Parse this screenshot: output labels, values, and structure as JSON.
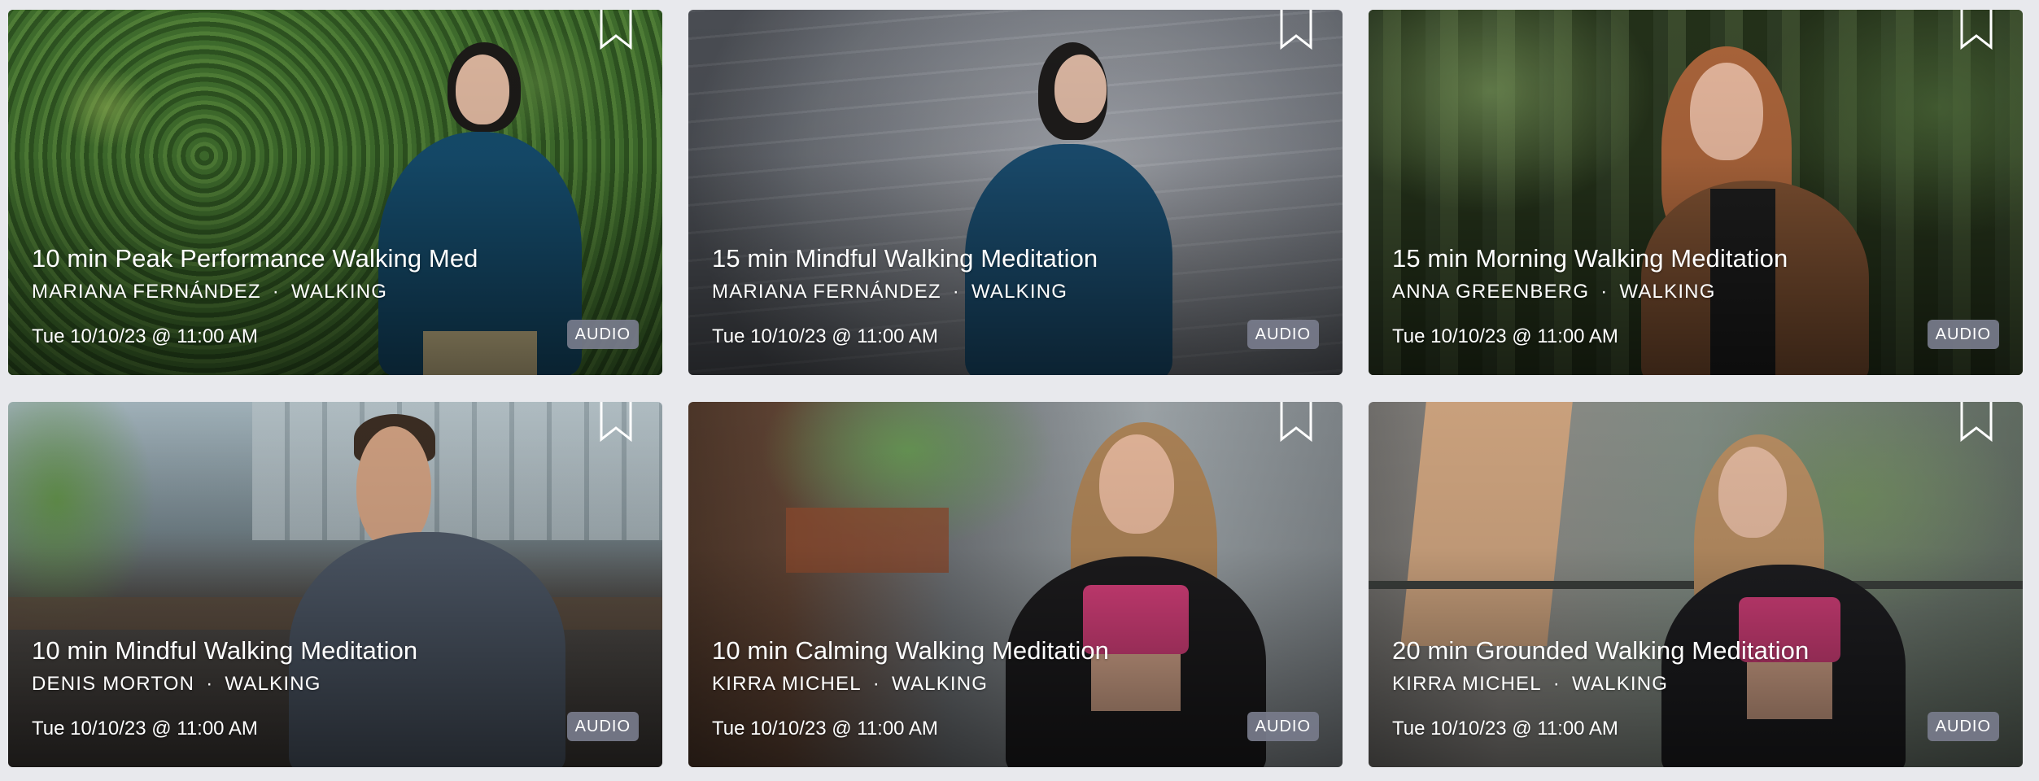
{
  "cards": [
    {
      "title": "10 min Peak Performance Walking Med",
      "instructor": "MARIANA FERNÁNDEZ",
      "discipline": "WALKING",
      "date": "Tue 10/10/23 @ 11:00 AM",
      "badge": "AUDIO",
      "bookmark_icon": "bookmark-icon"
    },
    {
      "title": "15 min Mindful Walking Meditation",
      "instructor": "MARIANA FERNÁNDEZ",
      "discipline": "WALKING",
      "date": "Tue 10/10/23 @ 11:00 AM",
      "badge": "AUDIO",
      "bookmark_icon": "bookmark-icon"
    },
    {
      "title": "15 min Morning Walking Meditation",
      "instructor": "ANNA GREENBERG",
      "discipline": "WALKING",
      "date": "Tue 10/10/23 @ 11:00 AM",
      "badge": "AUDIO",
      "bookmark_icon": "bookmark-icon"
    },
    {
      "title": "10 min Mindful Walking Meditation",
      "instructor": "DENIS MORTON",
      "discipline": "WALKING",
      "date": "Tue 10/10/23 @ 11:00 AM",
      "badge": "AUDIO",
      "bookmark_icon": "bookmark-icon"
    },
    {
      "title": "10 min Calming Walking Meditation",
      "instructor": "KIRRA MICHEL",
      "discipline": "WALKING",
      "date": "Tue 10/10/23 @ 11:00 AM",
      "badge": "AUDIO",
      "bookmark_icon": "bookmark-icon"
    },
    {
      "title": "20 min Grounded Walking Meditation",
      "instructor": "KIRRA MICHEL",
      "discipline": "WALKING",
      "date": "Tue 10/10/23 @ 11:00 AM",
      "badge": "AUDIO",
      "bookmark_icon": "bookmark-icon"
    }
  ],
  "separator": "·",
  "colors": {
    "page_background": "#e8e9ed",
    "badge_background": "#787c8c",
    "text": "#ffffff"
  }
}
